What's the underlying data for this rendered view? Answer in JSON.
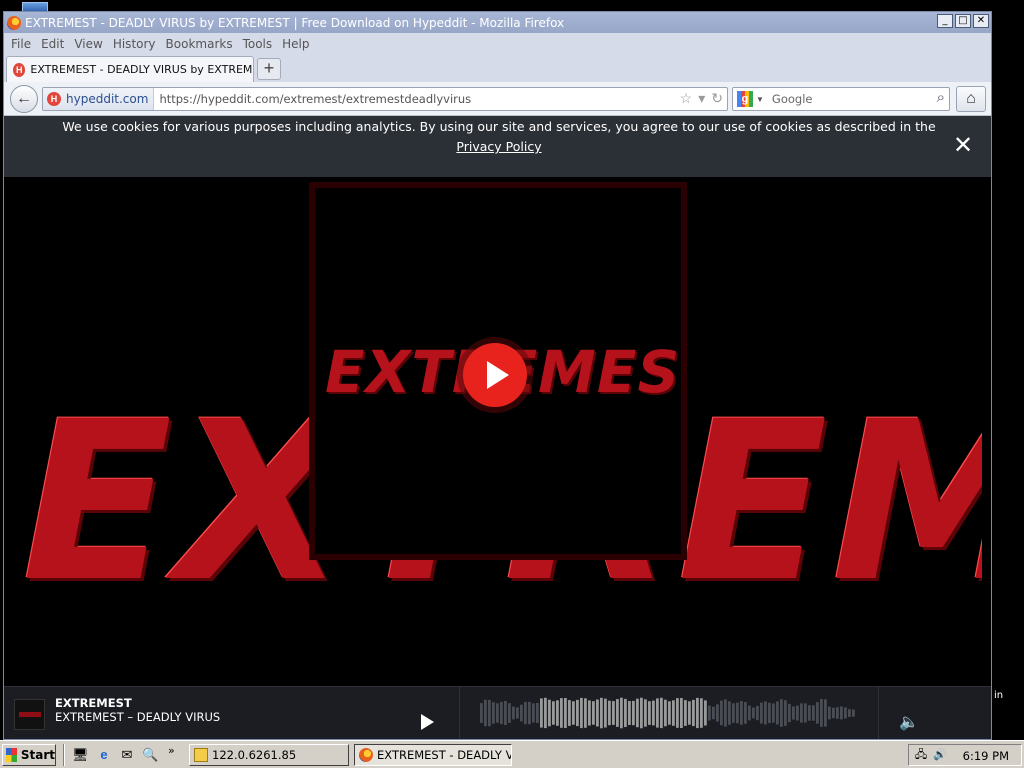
{
  "window": {
    "title": "EXTREMEST - DEADLY VIRUS by EXTREMEST | Free Download on Hypeddit - Mozilla Firefox",
    "controls": {
      "minimize": "_",
      "maximize": "□",
      "close": "✕"
    }
  },
  "menubar": {
    "items": [
      "File",
      "Edit",
      "View",
      "History",
      "Bookmarks",
      "Tools",
      "Help"
    ]
  },
  "tabs": [
    {
      "label": "EXTREMEST - DEADLY VIRUS by EXTREMEST...",
      "favicon": "H"
    }
  ],
  "new_tab_label": "+",
  "navbar": {
    "back_glyph": "←",
    "identity_icon": "H",
    "identity_label": "hypeddit.com",
    "url": "https://hypeddit.com/extremest/extremestdeadlyvirus",
    "search_engine_glyph": "g",
    "search_placeholder": "Google",
    "home_glyph": "⌂"
  },
  "cookie_banner": {
    "text": "We use cookies for various purposes including analytics. By using our site and services, you agree to our use of cookies as described in the",
    "link_label": "Privacy Policy",
    "close_glyph": "✕"
  },
  "artwork": {
    "logo_text": "EXTREMEST",
    "cover_logo_text": "EXTREMEST"
  },
  "player": {
    "artist": "EXTREMEST",
    "track": "EXTREMEST – DEADLY VIRUS",
    "played_fraction": 0.6,
    "volume_glyph": "🔈"
  },
  "taskbar": {
    "start_label": "Start",
    "quick_launch": [
      "🖥",
      "e",
      "✉",
      "🔍"
    ],
    "more_glyph": "»",
    "tasks": [
      {
        "label": "122.0.6261.85",
        "active": false
      },
      {
        "label": "EXTREMEST - DEADLY VI...",
        "active": true
      }
    ],
    "tray_icons": [
      "🖧",
      "🔊"
    ],
    "clock": "6:19 PM"
  },
  "desktop_side_text": "in",
  "colors": {
    "accent_red": "#e8231d",
    "logo_red": "#b5121b",
    "banner_bg": "#2b2f36",
    "player_bg": "#1b1d22"
  }
}
